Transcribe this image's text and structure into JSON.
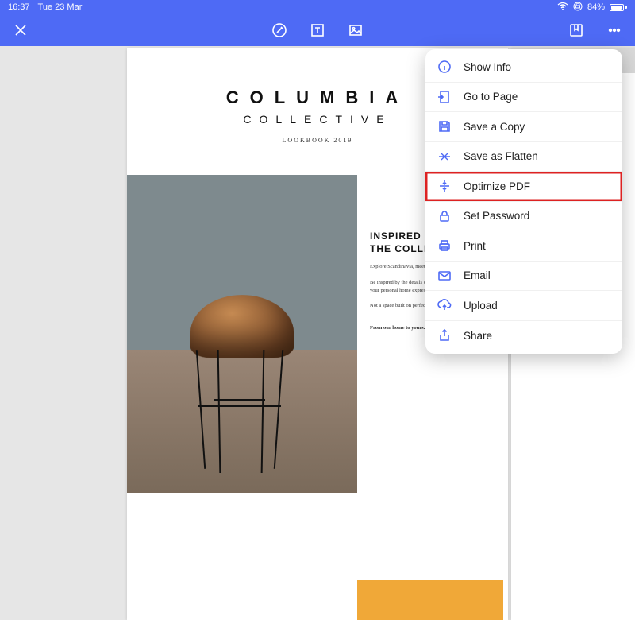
{
  "status": {
    "time": "16:37",
    "date": "Tue 23 Mar",
    "battery_pct": "84%"
  },
  "menu": {
    "items": [
      {
        "label": "Show Info"
      },
      {
        "label": "Go to Page"
      },
      {
        "label": "Save a Copy"
      },
      {
        "label": "Save as Flatten"
      },
      {
        "label": "Optimize PDF"
      },
      {
        "label": "Set Password"
      },
      {
        "label": "Print"
      },
      {
        "label": "Email"
      },
      {
        "label": "Upload"
      },
      {
        "label": "Share"
      }
    ],
    "highlighted_index": 4
  },
  "document": {
    "title_big": "COLUMBIA",
    "title_sub": "COLLECTIVE",
    "title_small": "LOOKBOOK 2019",
    "headline1": "INSPIRED BY",
    "headline2": "THE COLLECTIVE",
    "para1": "Explore Scandinavia, meet local and renowned designers.",
    "para2": "Be inspired by the details of each design and passion to find your personal home expression.",
    "para3": "Not a space built on perfection, a home made for living.",
    "para4": "From our home to yours."
  }
}
